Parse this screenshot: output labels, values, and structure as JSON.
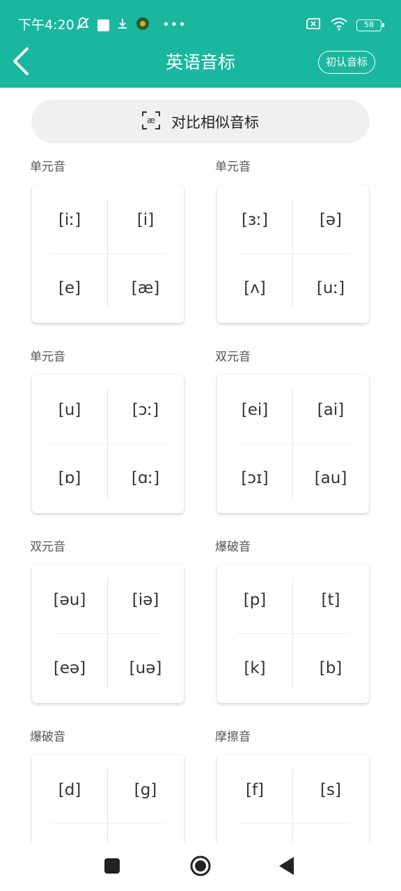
{
  "status_bar": {
    "time": "下午4:20",
    "battery_level": "58",
    "icons_left": [
      "mute-icon",
      "square-icon",
      "download-icon",
      "app-badge-icon",
      "more-dots-icon"
    ],
    "icons_right": [
      "sim-none-icon",
      "wifi-icon",
      "battery-icon"
    ]
  },
  "app_bar": {
    "title": "英语音标",
    "recognize_label": "初认音标",
    "back_icon": "chevron-left-icon"
  },
  "compare_button": {
    "label": "对比相似音标",
    "icon_text": "æ"
  },
  "groups": [
    {
      "label": "单元音",
      "items": [
        "[iː]",
        "[i]",
        "[e]",
        "[æ]"
      ]
    },
    {
      "label": "单元音",
      "items": [
        "[ɜː]",
        "[ə]",
        "[ʌ]",
        "[uː]"
      ]
    },
    {
      "label": "单元音",
      "items": [
        "[u]",
        "[ɔː]",
        "[ɒ]",
        "[ɑː]"
      ]
    },
    {
      "label": "双元音",
      "items": [
        "[ei]",
        "[ai]",
        "[ɔɪ]",
        "[au]"
      ]
    },
    {
      "label": "双元音",
      "items": [
        "[əu]",
        "[iə]",
        "[eə]",
        "[uə]"
      ]
    },
    {
      "label": "爆破音",
      "items": [
        "[p]",
        "[t]",
        "[k]",
        "[b]"
      ]
    },
    {
      "label": "爆破音",
      "items": [
        "[d]",
        "[g]"
      ]
    },
    {
      "label": "摩擦音",
      "items": [
        "[f]",
        "[s]"
      ]
    }
  ],
  "nav_bar": {
    "icons": [
      "recent-apps-icon",
      "home-icon",
      "back-triangle-icon"
    ]
  },
  "colors": {
    "brand": "#1ab79f",
    "card_bg": "#ffffff",
    "text": "#333333"
  }
}
